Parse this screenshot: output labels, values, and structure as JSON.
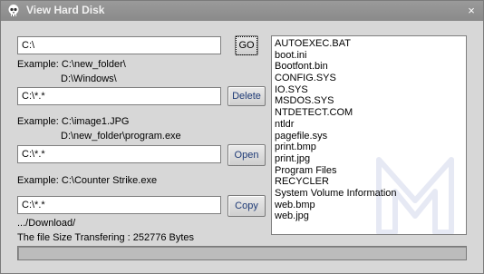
{
  "window": {
    "title": "View Hard Disk",
    "close_glyph": "×",
    "icon": "skull-icon"
  },
  "path_input": {
    "value": "C:\\"
  },
  "go_button": {
    "label": "GO"
  },
  "path_example": {
    "line1": "Example: C:\\new_folder\\",
    "line2": "D:\\Windows\\"
  },
  "delete_input": {
    "value": "C:\\*.*"
  },
  "delete_button": {
    "label": "Delete"
  },
  "delete_example": {
    "line1": "Example: C:\\image1.JPG",
    "line2": "D:\\new_folder\\program.exe"
  },
  "open_input": {
    "value": "C:\\*.*"
  },
  "open_button": {
    "label": "Open"
  },
  "open_example": {
    "line1": "Example: C:\\Counter Strike.exe"
  },
  "copy_input": {
    "value": "C:\\*.*"
  },
  "copy_button": {
    "label": "Copy"
  },
  "download_path": ".../Download/",
  "transfer_status": "The file Size Transfering : 252776 Bytes",
  "progress": {
    "fraction": 0.0
  },
  "files": [
    "AUTOEXEC.BAT",
    "boot.ini",
    "Bootfont.bin",
    "CONFIG.SYS",
    "IO.SYS",
    "MSDOS.SYS",
    "NTDETECT.COM",
    "ntldr",
    "pagefile.sys",
    "print.bmp",
    "print.jpg",
    "Program Files",
    "RECYCLER",
    "System Volume Information",
    "web.bmp",
    "web.jpg"
  ]
}
